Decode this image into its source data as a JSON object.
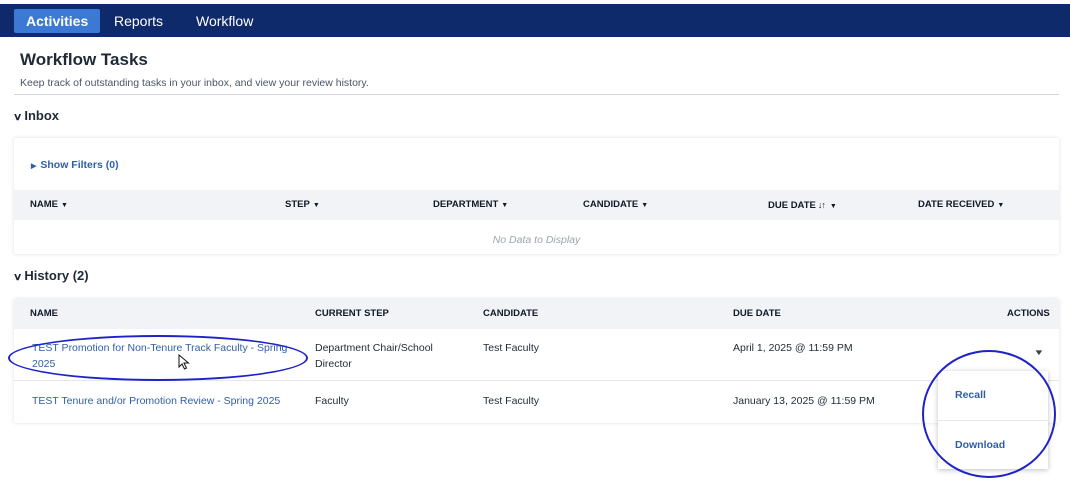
{
  "nav": {
    "tabs": [
      {
        "label": "Activities",
        "active": true
      },
      {
        "label": "Reports",
        "active": false
      },
      {
        "label": "Workflow",
        "active": false
      }
    ]
  },
  "page": {
    "title": "Workflow Tasks",
    "description": "Keep track of outstanding tasks in your inbox, and view your review history."
  },
  "inbox": {
    "heading": "Inbox",
    "show_filters": "Show Filters (0)",
    "columns": [
      "NAME",
      "STEP",
      "DEPARTMENT",
      "CANDIDATE",
      "DUE DATE",
      "DATE RECEIVED"
    ],
    "empty_text": "No Data to Display"
  },
  "history": {
    "heading": "History (2)",
    "columns": [
      "NAME",
      "CURRENT STEP",
      "CANDIDATE",
      "DUE DATE",
      "ACTIONS"
    ],
    "rows": [
      {
        "name_line1": "TEST Promotion for Non-Tenure Track Faculty - Spring",
        "name_line2": "2025",
        "step_line1": "Department Chair/School",
        "step_line2": "Director",
        "candidate": "Test Faculty",
        "due_date": "April 1, 2025 @ 11:59 PM"
      },
      {
        "name": "TEST Tenure and/or Promotion Review - Spring 2025",
        "step": "Faculty",
        "candidate": "Test Faculty",
        "due_date": "January 13, 2025 @ 11:59 PM"
      }
    ]
  },
  "actions_menu": {
    "items": [
      "Recall",
      "Download"
    ]
  },
  "colors": {
    "nav_bg": "#0f2a6b",
    "nav_active": "#3b79d4",
    "link": "#2f5ea8",
    "annotation": "#1f22c7"
  }
}
